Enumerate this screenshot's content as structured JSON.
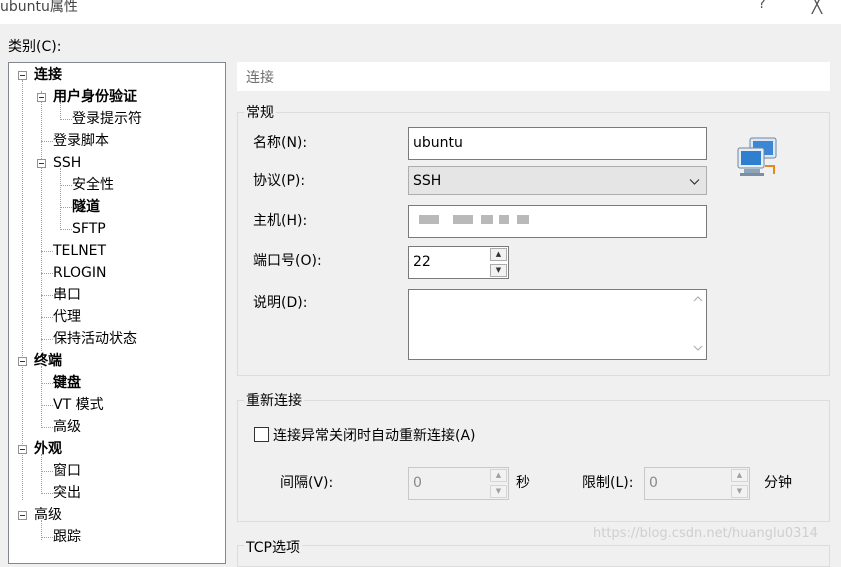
{
  "window": {
    "title": "ubuntu属性",
    "help": "?",
    "close": "╳"
  },
  "category_label": "类别(C):",
  "tree": {
    "items": [
      {
        "label": "连接"
      },
      {
        "label": "用户身份验证"
      },
      {
        "label": "登录提示符"
      },
      {
        "label": "登录脚本"
      },
      {
        "label": "SSH"
      },
      {
        "label": "安全性"
      },
      {
        "label": "隧道"
      },
      {
        "label": "SFTP"
      },
      {
        "label": "TELNET"
      },
      {
        "label": "RLOGIN"
      },
      {
        "label": "串口"
      },
      {
        "label": "代理"
      },
      {
        "label": "保持活动状态"
      },
      {
        "label": "终端"
      },
      {
        "label": "键盘"
      },
      {
        "label": "VT 模式"
      },
      {
        "label": "高级"
      },
      {
        "label": "外观"
      },
      {
        "label": "窗口"
      },
      {
        "label": "突出"
      },
      {
        "label": "高级"
      },
      {
        "label": "跟踪"
      }
    ]
  },
  "header": "连接",
  "general": {
    "title": "常规",
    "name_label": "名称(N):",
    "name_value": "ubuntu",
    "protocol_label": "协议(P):",
    "protocol_value": "SSH",
    "host_label": "主机(H):",
    "port_label": "端口号(O):",
    "port_value": "22",
    "desc_label": "说明(D):"
  },
  "reconnect": {
    "title": "重新连接",
    "checkbox_label": "连接异常关闭时自动重新连接(A)",
    "interval_label": "间隔(V):",
    "interval_value": "0",
    "interval_unit": "秒",
    "limit_label": "限制(L):",
    "limit_value": "0",
    "limit_unit": "分钟"
  },
  "tcp": {
    "title": "TCP选项"
  },
  "watermark": "https://blog.csdn.net/huanglu0314"
}
